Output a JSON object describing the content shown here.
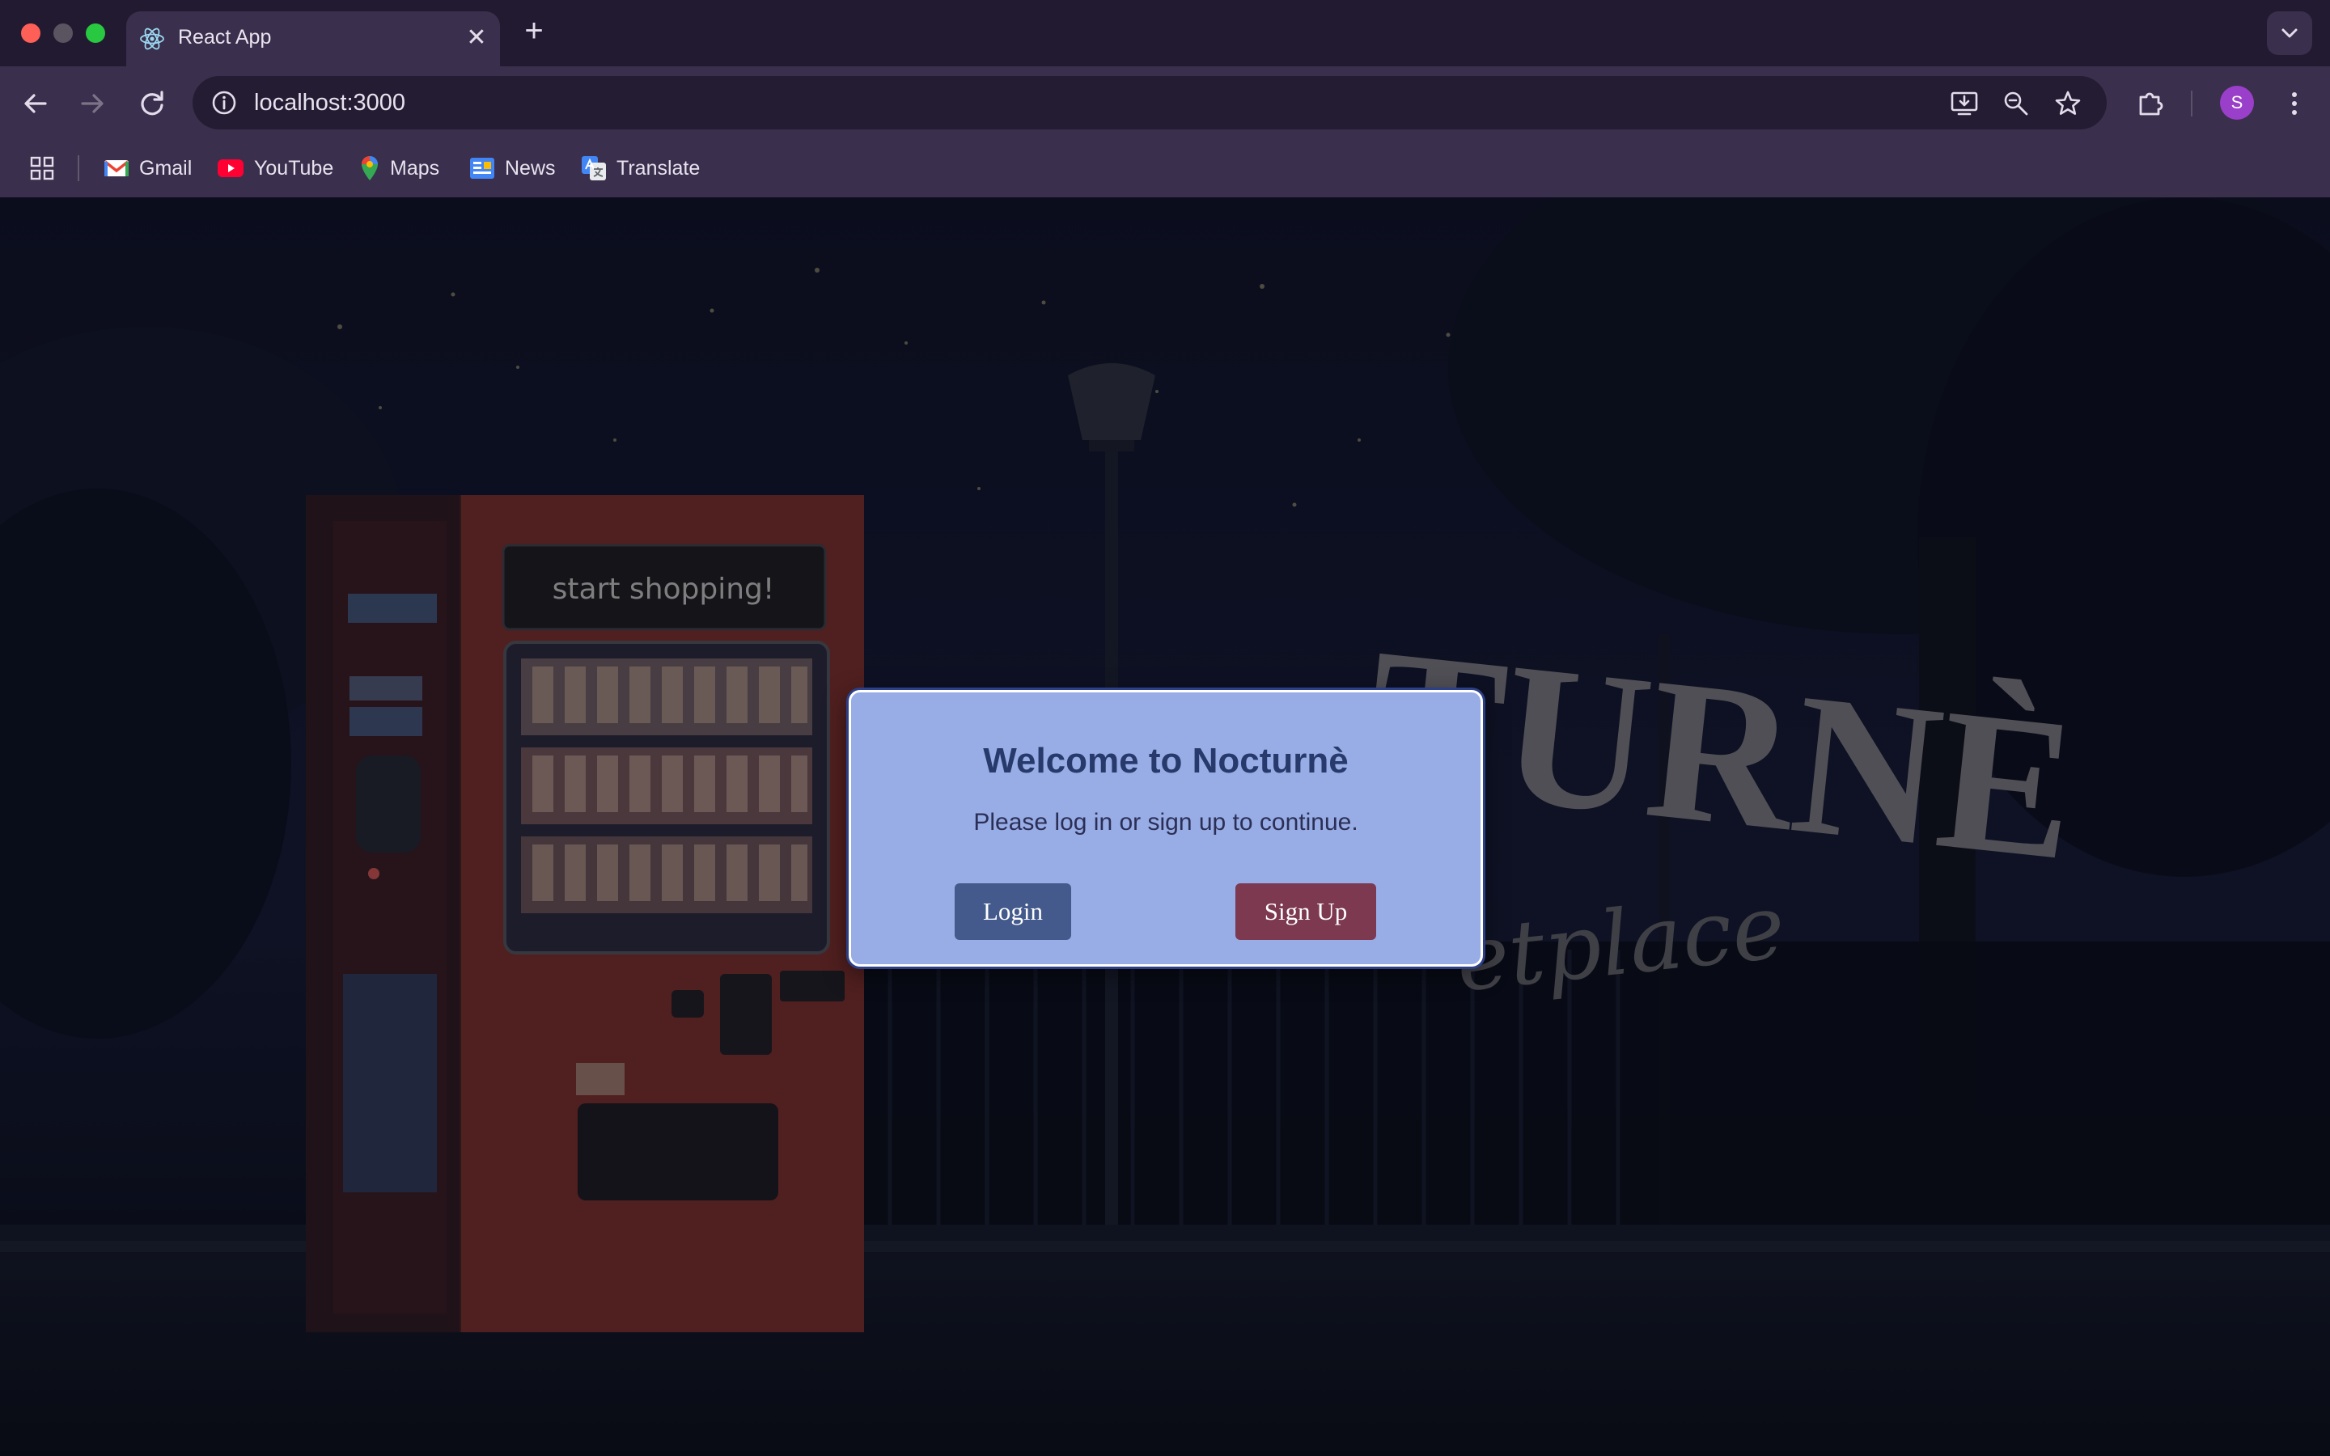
{
  "browser": {
    "tab": {
      "title": "React App"
    },
    "address_bar": {
      "url": "localhost:3000"
    },
    "profile_initial": "S",
    "bookmarks": [
      {
        "label": "Gmail",
        "icon": "gmail-icon"
      },
      {
        "label": "YouTube",
        "icon": "youtube-icon"
      },
      {
        "label": "Maps",
        "icon": "maps-icon"
      },
      {
        "label": "News",
        "icon": "news-icon"
      },
      {
        "label": "Translate",
        "icon": "translate-icon"
      }
    ]
  },
  "background": {
    "vending_machine_sign": "start shopping!",
    "brand_fragment": "TURNÈ",
    "tagline_fragment": "etplace"
  },
  "modal": {
    "title": "Welcome to Nocturnè",
    "message": "Please log in or sign up to continue.",
    "login_label": "Login",
    "signup_label": "Sign Up"
  },
  "colors": {
    "modal_bg": "#98ade6",
    "login_button": "#445a8c",
    "signup_button": "#7c3950",
    "browser_frame": "#3a2f4c"
  }
}
